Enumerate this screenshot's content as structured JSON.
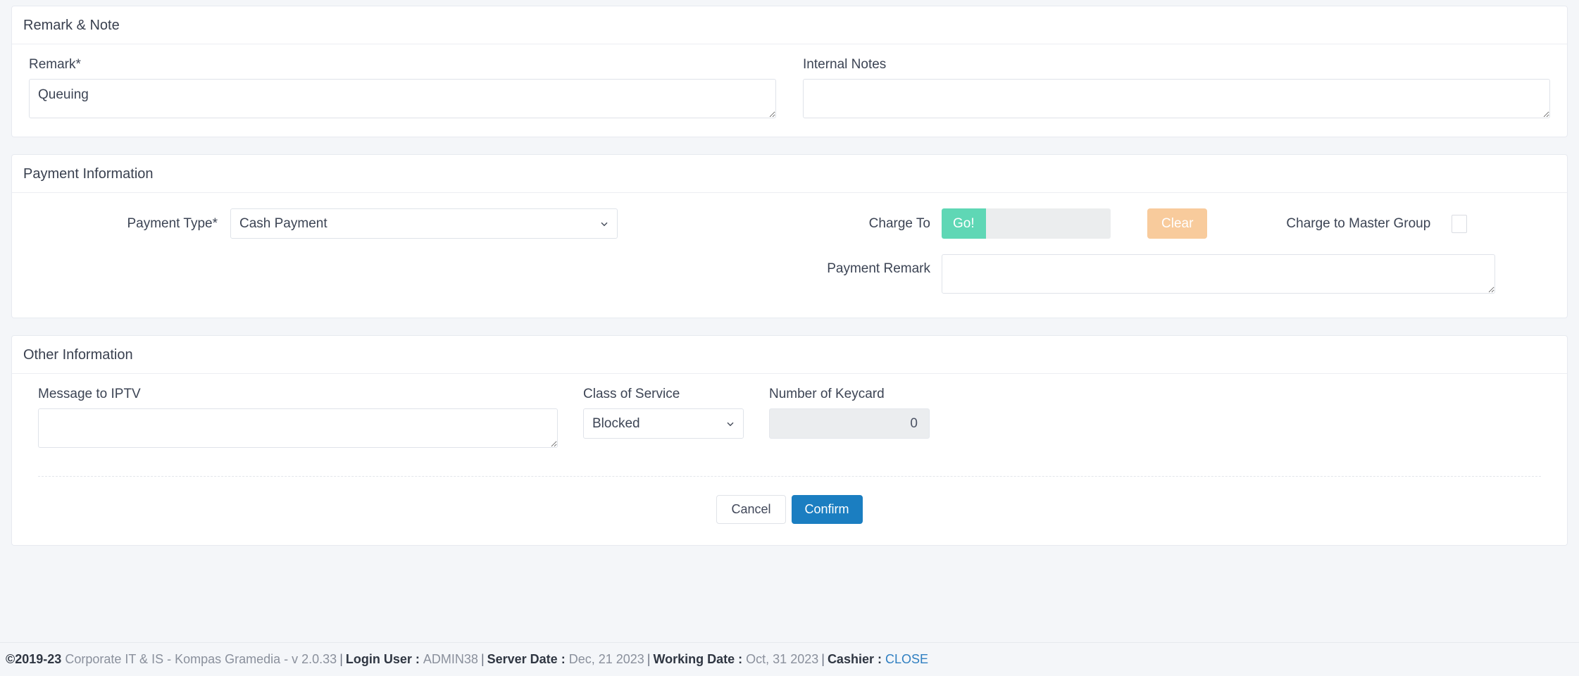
{
  "remark_note": {
    "title": "Remark & Note",
    "remark": {
      "label": "Remark*",
      "value": "Queuing",
      "placeholder": ""
    },
    "internal_notes": {
      "label": "Internal Notes",
      "value": "",
      "placeholder": ""
    }
  },
  "payment_information": {
    "title": "Payment Information",
    "payment_type": {
      "label": "Payment Type*",
      "selected": "Cash Payment",
      "options": [
        "Cash Payment"
      ]
    },
    "charge_to": {
      "label": "Charge To",
      "go_label": "Go!",
      "value": "",
      "placeholder": "",
      "clear_label": "Clear"
    },
    "charge_to_master_group": {
      "label": "Charge to Master Group",
      "checked": false
    },
    "payment_remark": {
      "label": "Payment Remark",
      "value": "",
      "placeholder": ""
    }
  },
  "other_information": {
    "title": "Other Information",
    "message_to_iptv": {
      "label": "Message to IPTV",
      "value": "",
      "placeholder": ""
    },
    "class_of_service": {
      "label": "Class of Service",
      "selected": "Blocked",
      "options": [
        "Blocked"
      ]
    },
    "number_of_keycard": {
      "label": "Number of Keycard",
      "value": "0"
    }
  },
  "actions": {
    "cancel_label": "Cancel",
    "confirm_label": "Confirm"
  },
  "footer": {
    "copyright": "©2019-23",
    "company": "Corporate IT & IS - Kompas Gramedia - v 2.0.33",
    "login_user_label": "Login User :",
    "login_user_value": "ADMIN38",
    "server_date_label": "Server Date :",
    "server_date_value": "Dec, 21 2023",
    "working_date_label": "Working Date :",
    "working_date_value": "Oct, 31 2023",
    "cashier_label": "Cashier :",
    "cashier_value": "CLOSE",
    "separator": "|"
  },
  "colors": {
    "go_button": "#5fd7b5",
    "clear_button": "#f8cb9c",
    "confirm_button": "#1b7ec1",
    "link": "#2f7fc1",
    "page_background": "#f4f6f9"
  }
}
